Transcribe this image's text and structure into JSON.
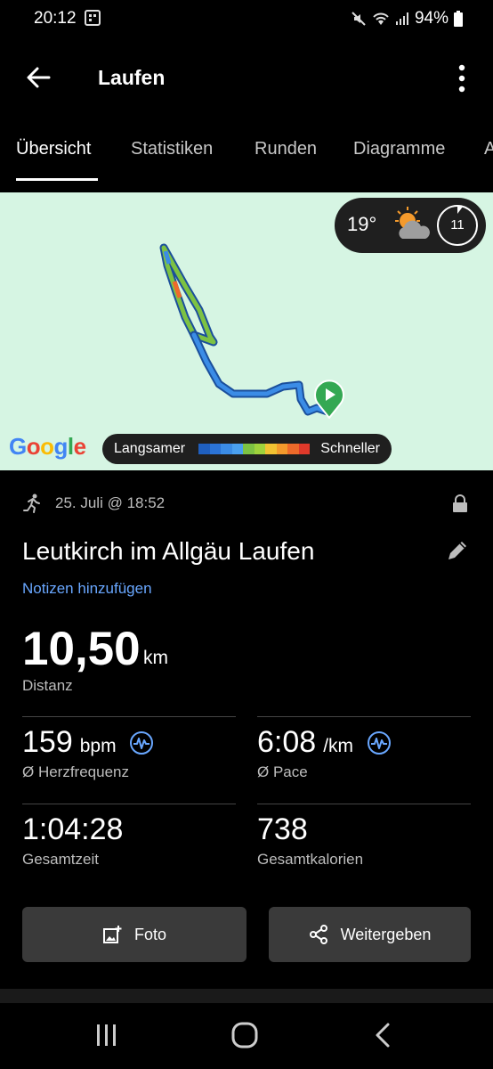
{
  "status_bar": {
    "time": "20:12",
    "battery": "94%"
  },
  "app_bar": {
    "title": "Laufen"
  },
  "tabs": [
    "Übersicht",
    "Statistiken",
    "Runden",
    "Diagramme",
    "A"
  ],
  "map": {
    "temperature": "19°",
    "clock_value": "11",
    "google_logo": "Google",
    "legend_slow": "Langsamer",
    "legend_fast": "Schneller",
    "legend_colors": [
      "#1f5fbf",
      "#2b73d6",
      "#3b8ce6",
      "#4aa0ef",
      "#7dc243",
      "#9fd23c",
      "#f2c232",
      "#f49a2c",
      "#ee6a2a",
      "#e0392a"
    ]
  },
  "activity": {
    "date": "25. Juli @ 18:52",
    "title": "Leutkirch im Allgäu Laufen",
    "notes_link": "Notizen hinzufügen",
    "distance": {
      "value": "10,50",
      "unit": "km",
      "label": "Distanz"
    },
    "heart_rate": {
      "value": "159",
      "unit": "bpm",
      "label": "Ø Herzfrequenz"
    },
    "pace": {
      "value": "6:08",
      "unit": "/km",
      "label": "Ø Pace"
    },
    "total_time": {
      "value": "1:04:28",
      "label": "Gesamtzeit"
    },
    "calories": {
      "value": "738",
      "label": "Gesamtkalorien"
    }
  },
  "buttons": {
    "photo": "Foto",
    "share": "Weitergeben"
  },
  "colors": {
    "accent": "#69a7ff",
    "map_bg": "#d6f5e3",
    "route_blue": "#3b8ce6",
    "route_green": "#7dc243",
    "start_marker": "#34a853"
  }
}
